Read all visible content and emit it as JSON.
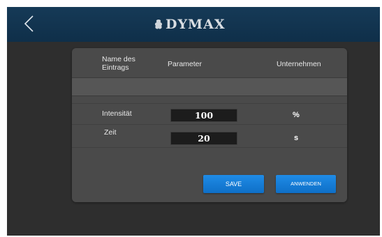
{
  "header": {
    "logo_text": "DYMAX",
    "logo_mark_icon": "dymax-logo-icon",
    "back_icon": "chevron-left-icon"
  },
  "table": {
    "columns": [
      "Name des Eintrags",
      "Parameter",
      "Unternehmen"
    ],
    "rows": [
      {
        "label": "Intensität",
        "value": "100",
        "unit": "%"
      },
      {
        "label": "Zeit",
        "value": "20",
        "unit": "s"
      }
    ]
  },
  "actions": {
    "save_label": "SAVE",
    "apply_label": "ANWENDEN"
  },
  "colors": {
    "header_bg": "#163a57",
    "screen_bg": "#2e2e2e",
    "panel_bg": "#4a4a4a",
    "button_blue": "#1a82dc"
  }
}
